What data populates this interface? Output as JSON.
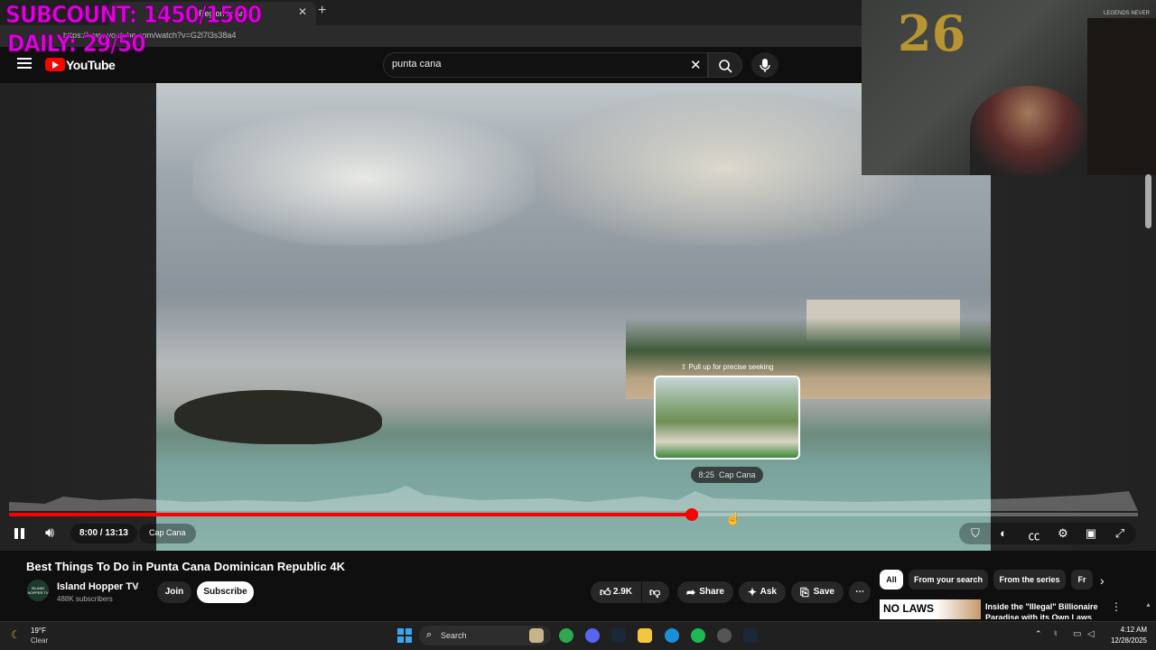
{
  "browser": {
    "tab_title": "Region in Ar",
    "url": "https://www.youtube.com/watch?v=G2l7l3s38a4"
  },
  "overlay": {
    "subcount": "SUBCOUNT: 1450/1500",
    "daily": "DAILY: 29/50"
  },
  "header": {
    "wordmark": "YouTube",
    "search_value": "punta cana"
  },
  "player": {
    "hover_hint": "Pull up for precise seeking",
    "hover_time": "8:25",
    "hover_chapter": "Cap Cana",
    "time_current": "8:00",
    "time_total": "13:13",
    "chapter": "Cap Cana",
    "progress_fraction": 0.605
  },
  "webcam": {
    "balloon_text": "26",
    "banner_text": "LEGENDS NEVER"
  },
  "video_info": {
    "title": "Best Things To Do in Punta Cana Dominican Republic 4K",
    "channel_name": "Island Hopper TV",
    "avatar_text": "ISLAND HOPPER TV",
    "subscribers": "488K subscribers",
    "join_label": "Join",
    "subscribe_label": "Subscribe",
    "likes": "2.9K",
    "share_label": "Share",
    "ask_label": "Ask",
    "save_label": "Save"
  },
  "chips": {
    "all": "All",
    "from_search": "From your search",
    "from_series": "From the series",
    "partial": "Fr"
  },
  "recommendation": {
    "thumb_text": "NO LAWS",
    "title": "Inside the \"Illegal\" Billionaire Paradise with its Own Laws"
  },
  "taskbar": {
    "weather_temp": "19°F",
    "weather_desc": "Clear",
    "search_label": "Search",
    "time": "4:12 AM",
    "date": "12/28/2025"
  },
  "colors": {
    "accent": "#ff0000",
    "overlay_text": "#e000e0"
  }
}
